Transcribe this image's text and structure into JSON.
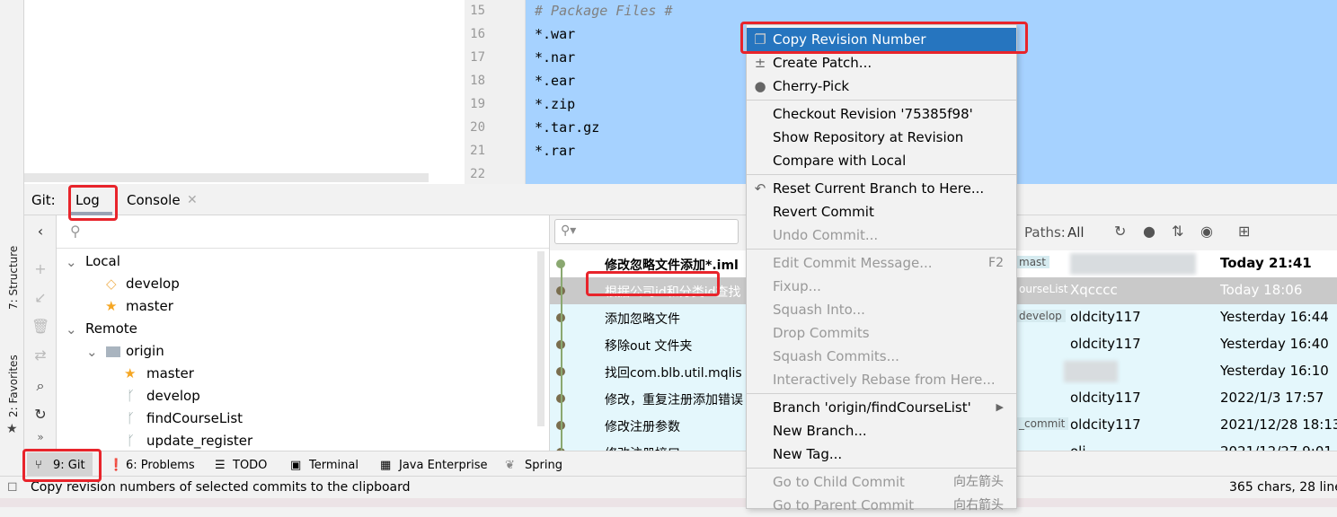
{
  "editor": {
    "line_numbers": [
      "15",
      "16",
      "17",
      "18",
      "19",
      "20",
      "21",
      "22"
    ],
    "lines": [
      "# Package Files #",
      "*.war",
      "*.nar",
      "*.ear",
      "*.zip",
      "*.tar.gz",
      "*.rar",
      ""
    ]
  },
  "side_tabs": {
    "structure": "7: Structure",
    "favorites": "2: Favorites"
  },
  "toolwindow": {
    "prefix": "Git:",
    "tabs": [
      "Log",
      "Console"
    ]
  },
  "branches": {
    "local_label": "Local",
    "local": [
      "develop",
      "master"
    ],
    "remote_label": "Remote",
    "origin": "origin",
    "remote": [
      "master",
      "develop",
      "findCourseList",
      "update_register"
    ]
  },
  "commits": {
    "search_placeholder": "",
    "paths_label": "Paths:",
    "paths_value": "All",
    "rows": [
      {
        "msg": "修改忽略文件添加*.iml",
        "ref": "mast",
        "author": "",
        "date": "Today 21:41"
      },
      {
        "msg": "根据公司id和分类id查找",
        "ref": "ourseList",
        "author": "Xqcccc",
        "date": "Today 18:06"
      },
      {
        "msg": "添加忽略文件",
        "ref": "develop",
        "author": "oldcity117",
        "date": "Yesterday 16:44"
      },
      {
        "msg": "移除out 文件夹",
        "ref": "",
        "author": "oldcity117",
        "date": "Yesterday 16:40"
      },
      {
        "msg": "找回com.blb.util.mqlis",
        "ref": "",
        "author": "",
        "date": "Yesterday 16:10"
      },
      {
        "msg": "修改，重复注册添加错误",
        "ref": "",
        "author": "oldcity117",
        "date": "2022/1/3 17:57"
      },
      {
        "msg": "修改注册参数",
        "ref": "_commit",
        "author": "oldcity117",
        "date": "2021/12/28 18:13"
      },
      {
        "msg": "修改注册接口",
        "ref": "",
        "author": "oli",
        "date": "2021/12/27 9:01"
      }
    ]
  },
  "bottom_tabs": [
    "9: Git",
    "6: Problems",
    "TODO",
    "Terminal",
    "Java Enterprise",
    "Spring"
  ],
  "status": {
    "message": "Copy revision numbers of selected commits to the clipboard",
    "right": "365 chars, 28 line"
  },
  "menu": {
    "groups": [
      [
        {
          "label": "Copy Revision Number",
          "icon": "copy-icon",
          "selected": true
        },
        {
          "label": "Create Patch...",
          "icon": "patch-icon"
        },
        {
          "label": "Cherry-Pick",
          "icon": "cherry-icon"
        }
      ],
      [
        {
          "label": "Checkout Revision '75385f98'"
        },
        {
          "label": "Show Repository at Revision"
        },
        {
          "label": "Compare with Local"
        }
      ],
      [
        {
          "label": "Reset Current Branch to Here...",
          "icon": "undo-icon"
        },
        {
          "label": "Revert Commit"
        },
        {
          "label": "Undo Commit...",
          "disabled": true
        }
      ],
      [
        {
          "label": "Edit Commit Message...",
          "shortcut": "F2",
          "disabled": true
        },
        {
          "label": "Fixup...",
          "disabled": true
        },
        {
          "label": "Squash Into...",
          "disabled": true
        },
        {
          "label": "Drop Commits",
          "disabled": true
        },
        {
          "label": "Squash Commits...",
          "disabled": true
        },
        {
          "label": "Interactively Rebase from Here...",
          "disabled": true
        }
      ],
      [
        {
          "label": "Branch 'origin/findCourseList'",
          "submenu": true
        },
        {
          "label": "New Branch..."
        },
        {
          "label": "New Tag..."
        }
      ],
      [
        {
          "label": "Go to Child Commit",
          "shortcut": "向左箭头",
          "disabled": true
        },
        {
          "label": "Go to Parent Commit",
          "shortcut": "向右箭头",
          "disabled": true
        }
      ]
    ]
  },
  "colors": {
    "selection": "#a6d2ff",
    "menu_highlight": "#2675bf",
    "annotation": "#e8242b",
    "commit_row": "#e4f7fc"
  }
}
